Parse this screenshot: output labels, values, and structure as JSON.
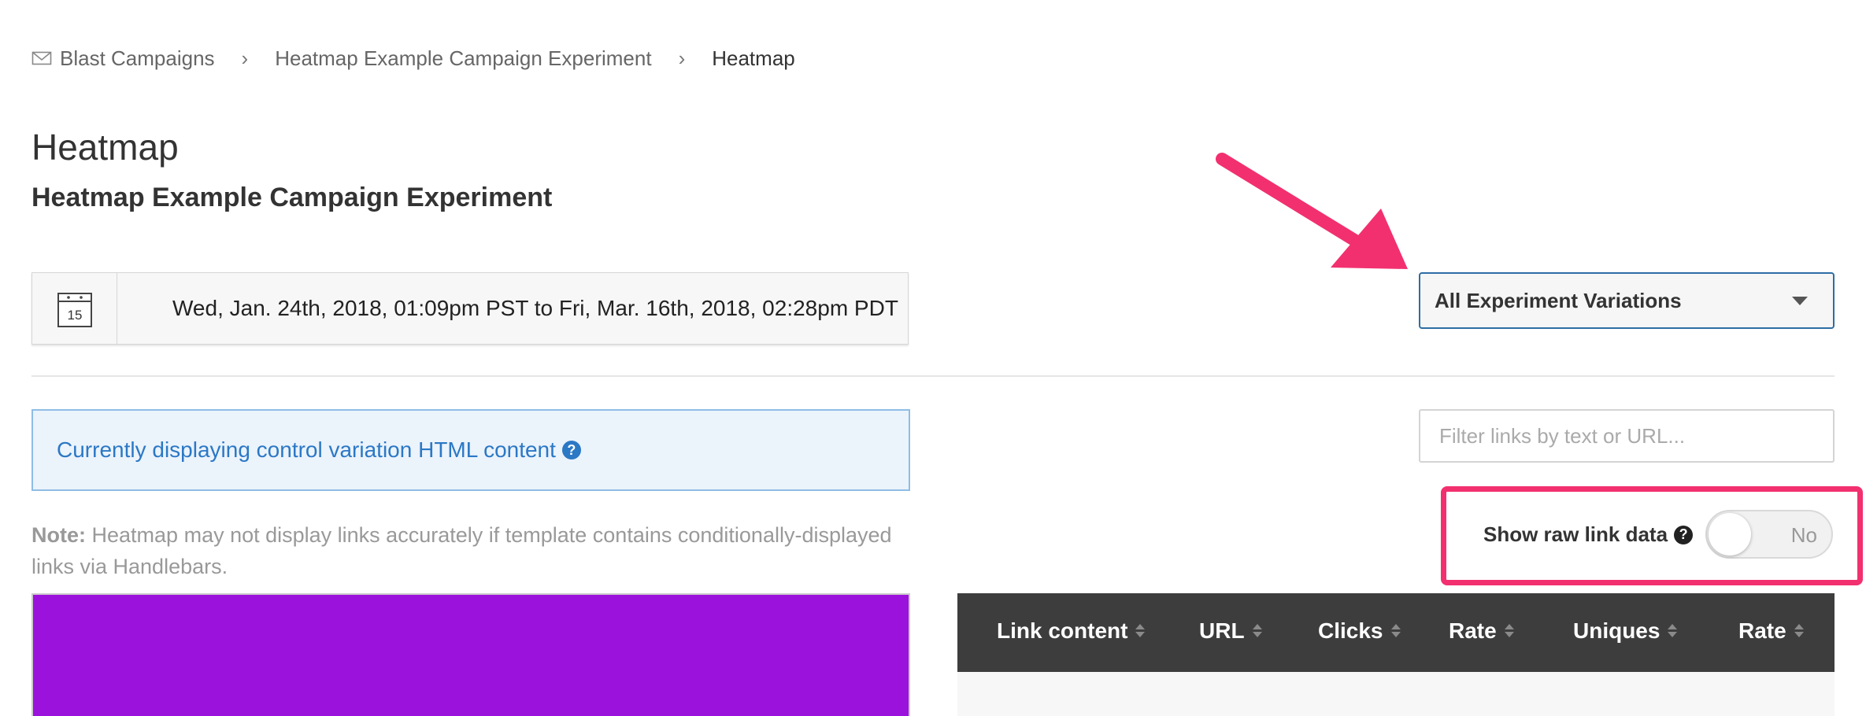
{
  "breadcrumb": {
    "icon": "envelope-icon",
    "items": [
      {
        "label": "Blast Campaigns"
      },
      {
        "label": "Heatmap Example Campaign Experiment"
      },
      {
        "label": "Heatmap"
      }
    ],
    "separator": "›"
  },
  "page": {
    "title": "Heatmap",
    "subtitle": "Heatmap Example Campaign Experiment"
  },
  "date_range": {
    "icon": "calendar-icon",
    "calendar_day": "15",
    "text": "Wed, Jan. 24th, 2018, 01:09pm PST to Fri, Mar. 16th, 2018, 02:28pm PDT"
  },
  "variation_select": {
    "selected": "All Experiment Variations",
    "icon": "chevron-down-icon"
  },
  "info_banner": {
    "text": "Currently displaying control variation HTML content",
    "help": "?"
  },
  "filter": {
    "placeholder": "Filter links by text or URL...",
    "value": ""
  },
  "note": {
    "label": "Note:",
    "text": "Heatmap may not display links accurately if template contains conditionally-displayed links via Handlebars."
  },
  "raw_toggle": {
    "label": "Show raw link data",
    "help": "?",
    "state": "No"
  },
  "table": {
    "columns": [
      "Link content",
      "URL",
      "Clicks",
      "Rate",
      "Uniques",
      "Rate"
    ]
  },
  "colors": {
    "accent_blue": "#2e6da4",
    "info_bg": "#ebf3fb",
    "info_text": "#2b78c5",
    "highlight_pink": "#f2306f",
    "preview_purple": "#9b12dd",
    "table_header": "#3d3d3d"
  }
}
